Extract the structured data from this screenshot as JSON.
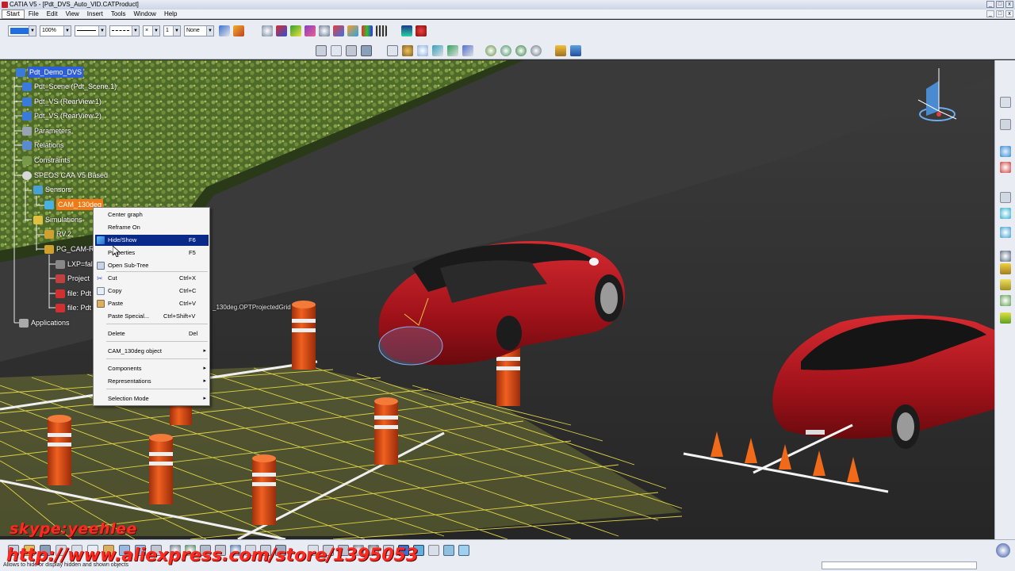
{
  "window": {
    "title": "CATIA V5 - [Pdt_DVS_Auto_VID.CATProduct]",
    "controls": [
      "_",
      "□",
      "x"
    ]
  },
  "menubar": {
    "items": [
      "Start",
      "File",
      "Edit",
      "View",
      "Insert",
      "Tools",
      "Window",
      "Help"
    ],
    "active_index": 0,
    "doc_controls": [
      "_",
      "□",
      "x"
    ]
  },
  "toolbar": {
    "zoom_value": "100%",
    "layer_value": "None",
    "line_weight_value": "1",
    "color_swatch": "#1f6fe0"
  },
  "spec_tree": {
    "nodes": [
      {
        "label": "Pdt_Demo_DVS",
        "style": "selected",
        "icon": "product-icon",
        "color": "#3a7ad8"
      },
      {
        "label": "Pdt_Scene (Pdt_Scene.1)",
        "style": "normal",
        "icon": "product-icon",
        "color": "#3a7ad8"
      },
      {
        "label": "Pdt_VS (RearView.1)",
        "style": "normal",
        "icon": "product-icon",
        "color": "#3a7ad8"
      },
      {
        "label": "Pdt_VS (RearView.2)",
        "style": "normal",
        "icon": "product-icon",
        "color": "#3a7ad8"
      },
      {
        "label": "Parameters",
        "style": "normal",
        "icon": "parameters-icon",
        "color": "#9aa3b0"
      },
      {
        "label": "Relations",
        "style": "normal",
        "icon": "relations-icon",
        "color": "#5a8ad0"
      },
      {
        "label": "Constraints",
        "style": "normal",
        "icon": "constraints-icon",
        "color": "#7a9a4a"
      },
      {
        "label": "SPEOS CAA V5 Based",
        "style": "normal",
        "icon": "speos-icon",
        "color": "#d8d8d8"
      },
      {
        "label": "Sensors",
        "style": "normal",
        "icon": "sensors-icon",
        "color": "#4aa0d0"
      },
      {
        "label": "CAM_130deg",
        "style": "orange",
        "icon": "camera-icon",
        "color": "#4ab0e0"
      },
      {
        "label": "Simulations",
        "style": "normal",
        "icon": "simulations-icon",
        "color": "#e0c040"
      },
      {
        "label": "RV.2",
        "style": "normal",
        "icon": "simulation-icon",
        "color": "#d0a030"
      },
      {
        "label": "PG_CAM-RE",
        "style": "normal",
        "icon": "simulation-icon",
        "color": "#d0a030"
      },
      {
        "label": "LXP=fals",
        "style": "normal",
        "icon": "result-icon",
        "color": "#888"
      },
      {
        "label": "Project",
        "style": "normal",
        "icon": "project-icon",
        "color": "#c04040"
      },
      {
        "label": "file: Pdt",
        "style": "normal",
        "icon": "file-icon",
        "color": "#d03030"
      },
      {
        "label": "file: Pdt",
        "style": "normal",
        "icon": "file-icon",
        "color": "#d03030"
      },
      {
        "label": "Applications",
        "style": "normal",
        "icon": "applications-icon",
        "color": "#aaa"
      }
    ],
    "overflow_text": "_130deg.OPTProjectedGrid"
  },
  "context_menu": {
    "items": [
      {
        "label": "Center graph",
        "accel": "",
        "submenu": false,
        "icon": ""
      },
      {
        "label": "Reframe On",
        "accel": "",
        "submenu": false,
        "icon": ""
      },
      {
        "label": "Hide/Show",
        "accel": "F6",
        "submenu": false,
        "icon": "hide-show-icon",
        "highlight": true
      },
      {
        "label": "Properties",
        "accel": "F5",
        "submenu": false,
        "icon": ""
      },
      {
        "label": "Open Sub-Tree",
        "accel": "",
        "submenu": false,
        "icon": "subtree-icon"
      },
      {
        "label": "Cut",
        "accel": "Ctrl+X",
        "submenu": false,
        "icon": "cut-icon"
      },
      {
        "label": "Copy",
        "accel": "Ctrl+C",
        "submenu": false,
        "icon": "copy-icon"
      },
      {
        "label": "Paste",
        "accel": "Ctrl+V",
        "submenu": false,
        "icon": "paste-icon"
      },
      {
        "label": "Paste Special...",
        "accel": "Ctrl+Shift+V",
        "submenu": false,
        "icon": ""
      },
      {
        "label": "Delete",
        "accel": "Del",
        "submenu": false,
        "icon": ""
      },
      {
        "label": "CAM_130deg object",
        "accel": "",
        "submenu": true,
        "icon": ""
      },
      {
        "label": "Components",
        "accel": "",
        "submenu": true,
        "icon": ""
      },
      {
        "label": "Representations",
        "accel": "",
        "submenu": true,
        "icon": ""
      },
      {
        "label": "Selection Mode",
        "accel": "",
        "submenu": true,
        "icon": ""
      }
    ]
  },
  "status": {
    "text": "Allows to hide or display hidden and shown objects"
  },
  "watermarks": {
    "skype": "skype:yeehlee",
    "store": "http://www.aliexpress.com/store/1395053"
  },
  "colors": {
    "car_red": "#b0141c",
    "grid_yellow": "#f2e64a",
    "bollard_orange": "#e8501a",
    "hedge_green": "#6b8a3a",
    "menu_highlight": "#0a2a8a",
    "selected_node": "#2f5fd8"
  }
}
